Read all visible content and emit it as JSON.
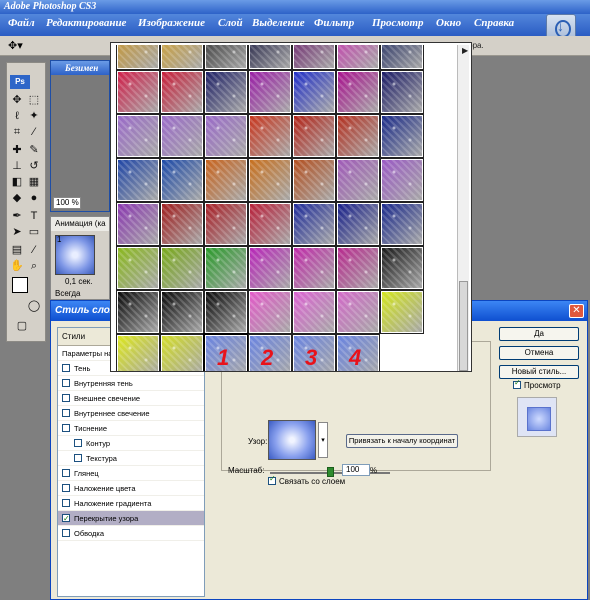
{
  "app": {
    "title": "Adobe Photoshop CS3",
    "menu": [
      "Файл",
      "Редактирование",
      "Изображение",
      "Слой",
      "Выделение",
      "Фильтр",
      "Просмотр",
      "Окно",
      "Справка"
    ],
    "options_tail": "вора."
  },
  "document": {
    "title": "Безимен",
    "zoom": "100 %"
  },
  "animation": {
    "tab": "Анимация (ка",
    "frame_number": "1",
    "delay": "0,1 сек.",
    "loop": "Всегда"
  },
  "layer_style": {
    "title": "Стиль слоя",
    "styles_header": "Стили",
    "blend_options": "Параметры на",
    "items": [
      {
        "label": "Тень",
        "checked": false,
        "sub": false
      },
      {
        "label": "Внутренняя тень",
        "checked": false,
        "sub": false
      },
      {
        "label": "Внешнее свечение",
        "checked": false,
        "sub": false
      },
      {
        "label": "Внутреннее свечение",
        "checked": false,
        "sub": false
      },
      {
        "label": "Тиснение",
        "checked": false,
        "sub": false
      },
      {
        "label": "Контур",
        "checked": false,
        "sub": true
      },
      {
        "label": "Текстура",
        "checked": false,
        "sub": true
      },
      {
        "label": "Глянец",
        "checked": false,
        "sub": false
      },
      {
        "label": "Наложение цвета",
        "checked": false,
        "sub": false
      },
      {
        "label": "Наложение градиента",
        "checked": false,
        "sub": false
      },
      {
        "label": "Перекрытие узора",
        "checked": true,
        "sub": false
      },
      {
        "label": "Обводка",
        "checked": false,
        "sub": false
      }
    ],
    "pattern_label": "Узор:",
    "snap_button": "Привязать к началу координат",
    "scale_label": "Масштаб:",
    "scale_value": "100",
    "scale_unit": "%",
    "scale_fraction": 0.5,
    "link_label": "Связать со слоем",
    "buttons": {
      "ok": "Да",
      "cancel": "Отмена",
      "new_style": "Новый стиль..."
    },
    "preview_label": "Просмотр"
  },
  "pattern_picker": {
    "numbers": [
      "1",
      "2",
      "3",
      "4"
    ],
    "rows": [
      [
        "#c9962c",
        "#d1a02f",
        "#333",
        "#1b1b40",
        "#6b1f6b",
        "#c83bb0",
        "#1f2a60"
      ],
      [
        "#d0204a",
        "#c81f3a",
        "#1f2166",
        "#9a1fa6",
        "#2230c8",
        "#a8128e",
        "#1b1b66"
      ],
      [
        "#9a6ac8",
        "#9a6ac8",
        "#9a6ac8",
        "#c8361e",
        "#b42418",
        "#b43020",
        "#1a2a88"
      ],
      [
        "#2046a6",
        "#1d4aa8",
        "#c8641e",
        "#c8701e",
        "#b45020",
        "#a05ab8",
        "#9a5ac4"
      ],
      [
        "#8a38b0",
        "#a01e1e",
        "#a81e26",
        "#b8203a",
        "#1f2c9a",
        "#18208a",
        "#1b2a8c"
      ],
      [
        "#8ab81e",
        "#78a81a",
        "#2a9a2a",
        "#b826b8",
        "#c02aa8",
        "#b82a8e",
        "#1a1a1a"
      ],
      [
        "#0a0a0a",
        "#0a0a0a",
        "#0a0a0a",
        "#e25ac8",
        "#dc64d2",
        "#d26ac8",
        "#d2e41e"
      ],
      [
        "#dce61e",
        "#d2dc28",
        "#6a84e0",
        "#6a84e0",
        "#6a84e0",
        "#6a84e0",
        null
      ]
    ]
  }
}
